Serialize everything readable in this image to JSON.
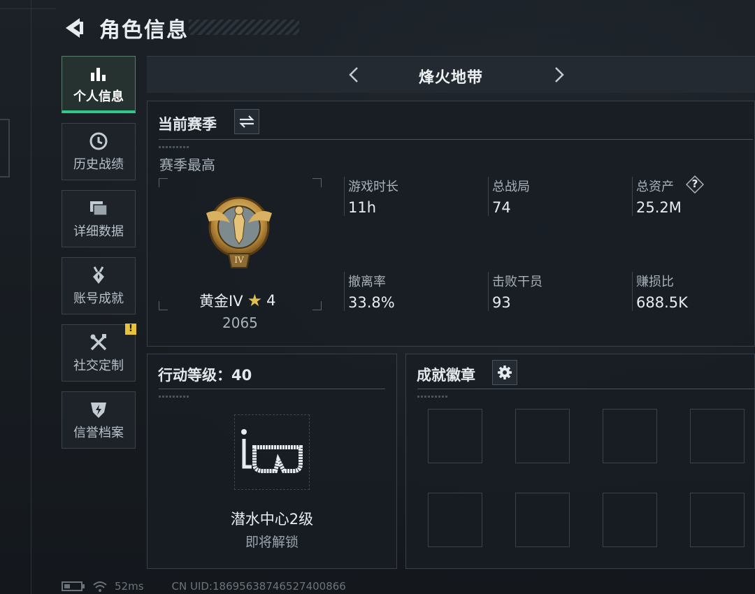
{
  "header": {
    "title": "角色信息"
  },
  "sidebar": {
    "items": [
      {
        "label": "个人信息",
        "icon": "bar-chart-icon",
        "active": true
      },
      {
        "label": "历史战绩",
        "icon": "history-clock-icon"
      },
      {
        "label": "详细数据",
        "icon": "folder-icon"
      },
      {
        "label": "账号成就",
        "icon": "medal-icon"
      },
      {
        "label": "社交定制",
        "icon": "tools-icon",
        "badge": "!"
      },
      {
        "label": "信誉档案",
        "icon": "shield-lightning-icon"
      }
    ]
  },
  "mode": {
    "title": "烽火地带"
  },
  "season": {
    "header": "当前赛季",
    "best_label": "赛季最高",
    "rank_name": "黄金IV",
    "rank_stars": "4",
    "rank_score": "2065",
    "rank_emblem_text": "IV",
    "stats": [
      {
        "label": "游戏时长",
        "value": "11h"
      },
      {
        "label": "总战局",
        "value": "74"
      },
      {
        "label": "总资产",
        "value": "25.2M",
        "help": "?"
      },
      {
        "label": "撤离率",
        "value": "33.8%"
      },
      {
        "label": "击败干员",
        "value": "93"
      },
      {
        "label": "赚损比",
        "value": "688.5K"
      }
    ]
  },
  "action_level": {
    "header": "行动等级：40",
    "unlock_name": "潜水中心2级",
    "unlock_status": "即将解锁"
  },
  "badges": {
    "header": "成就徽章"
  },
  "status": {
    "ping": "52ms",
    "uid": "CN UID:18695638746527400866"
  },
  "colors": {
    "accent_green": "#32c88a",
    "warning_yellow": "#e8c23a",
    "gold": "#c9a24a"
  }
}
